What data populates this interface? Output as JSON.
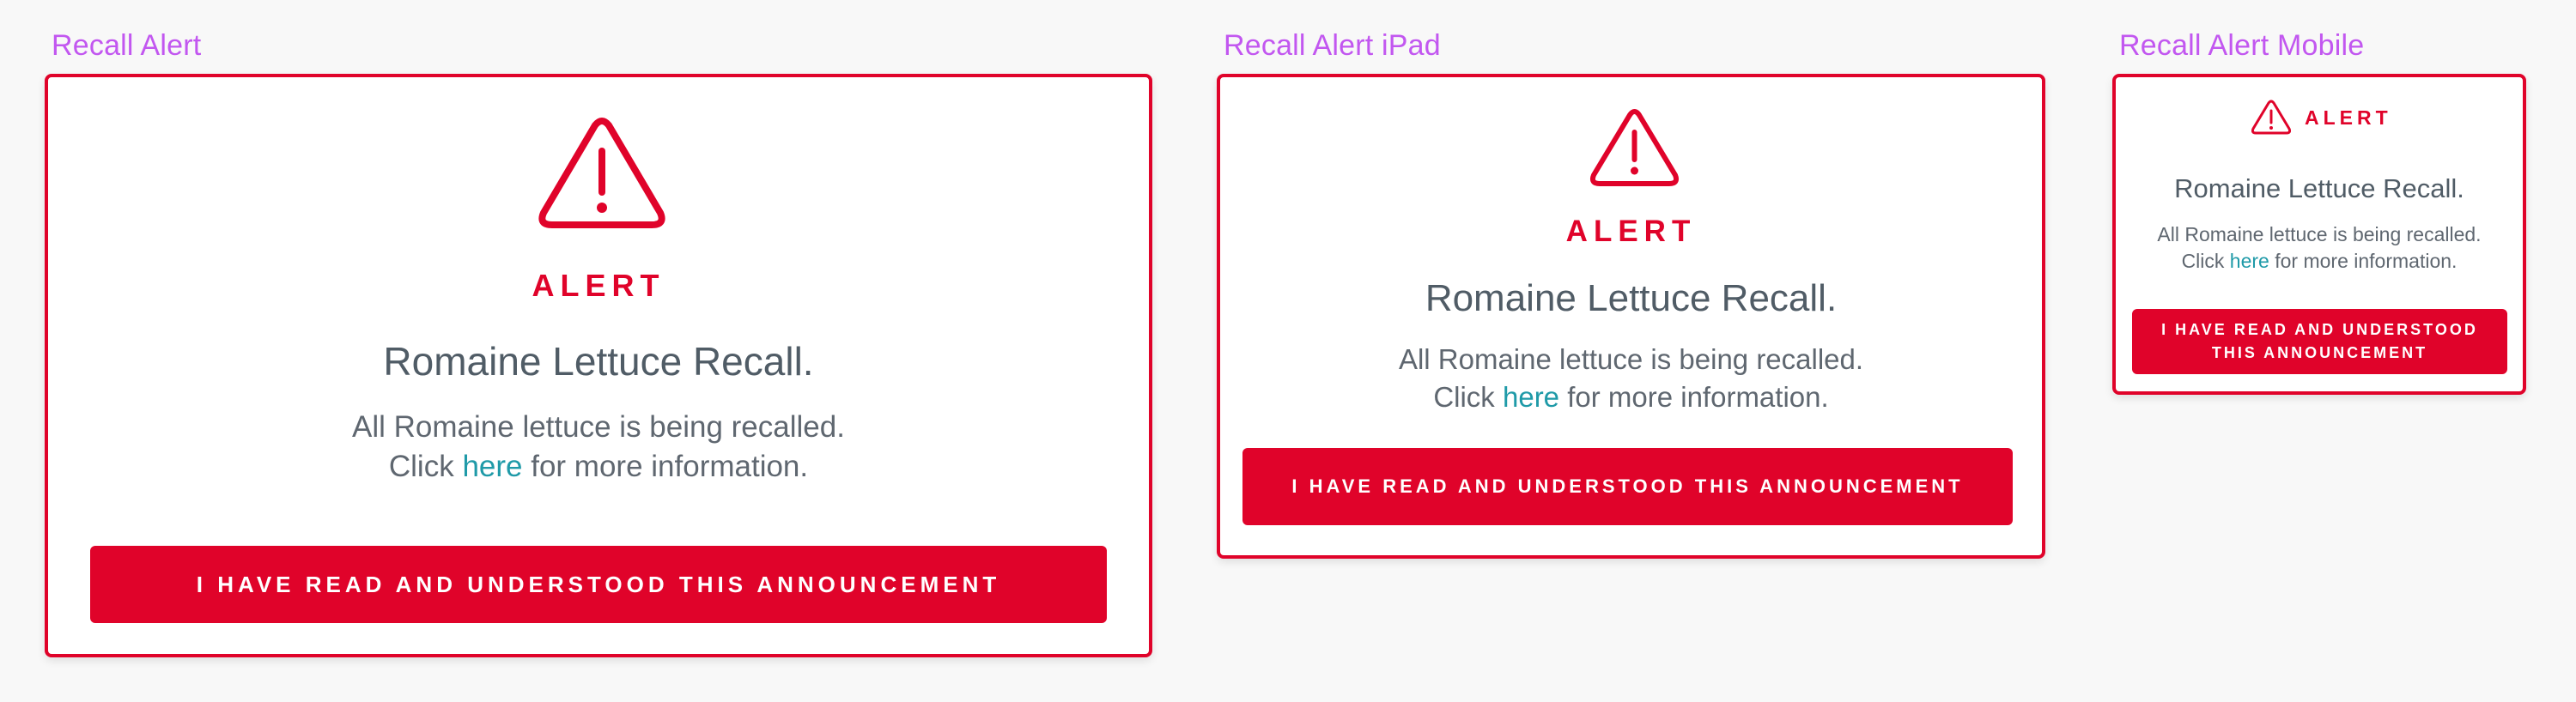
{
  "labels": {
    "desktop": "Recall Alert",
    "ipad": "Recall Alert iPad",
    "mobile": "Recall Alert Mobile"
  },
  "alert": {
    "word": "ALERT",
    "headline": "Romaine Lettuce Recall.",
    "body_line_1": "All Romaine lettuce is being recalled.",
    "body_line_2_prefix": "Click ",
    "link_text": "here",
    "body_line_2_suffix": " for more information.",
    "button_label": "I HAVE READ AND UNDERSTOOD THIS ANNOUNCEMENT",
    "icon": "warning-triangle-icon"
  },
  "colors": {
    "accent": "#e0032a",
    "label": "#c257f0",
    "link": "#1f9aa8",
    "headline": "#505c66",
    "background": "#f8f8f8"
  }
}
